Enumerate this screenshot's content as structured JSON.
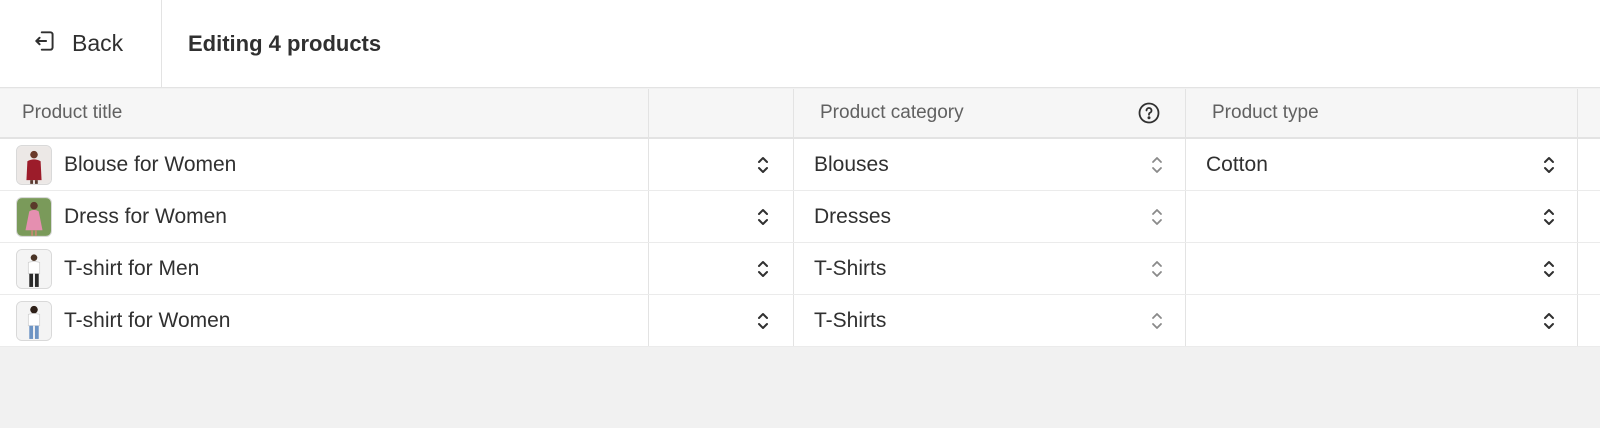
{
  "header": {
    "back_label": "Back",
    "title": "Editing 4 products"
  },
  "table": {
    "columns": {
      "title": "Product title",
      "category": "Product category",
      "type": "Product type"
    },
    "rows": [
      {
        "title": "Blouse for Women",
        "category": "Blouses",
        "type": "Cotton",
        "thumb": "red-blouse-photo"
      },
      {
        "title": "Dress for Women",
        "category": "Dresses",
        "type": "",
        "thumb": "pink-dress-photo"
      },
      {
        "title": "T-shirt for Men",
        "category": "T-Shirts",
        "type": "",
        "thumb": "white-tshirt-man-photo"
      },
      {
        "title": "T-shirt for Women",
        "category": "T-Shirts",
        "type": "",
        "thumb": "white-tshirt-woman-photo"
      }
    ]
  },
  "icons": {
    "back": "exit-arrow-icon",
    "help": "question-circle-icon",
    "stepper": "chevron-up-down-icon"
  },
  "colors": {
    "text": "#303030",
    "muted": "#616161",
    "header_bg": "#f6f6f6",
    "page_bg": "#f1f1f1"
  }
}
